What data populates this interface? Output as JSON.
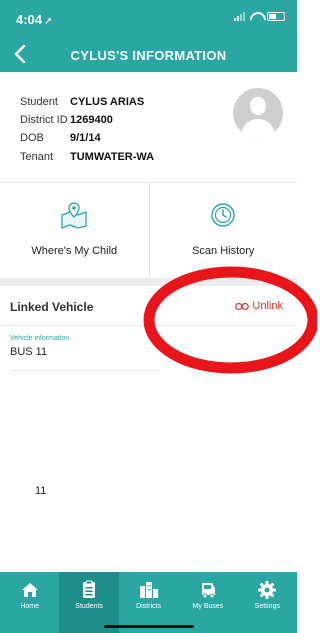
{
  "status_bar": {
    "time": "4:04"
  },
  "header": {
    "title": "CYLUS'S INFORMATION"
  },
  "student_info": {
    "rows": [
      {
        "label": "Student",
        "value": "CYLUS ARIAS"
      },
      {
        "label": "District ID",
        "value": "1269400"
      },
      {
        "label": "DOB",
        "value": "9/1/14"
      },
      {
        "label": "Tenant",
        "value": "TUMWATER-WA"
      }
    ]
  },
  "tiles": {
    "where": {
      "label": "Where's My Child",
      "icon": "map-location-icon"
    },
    "scan": {
      "label": "Scan History",
      "icon": "clock-history-icon"
    }
  },
  "linked_vehicle": {
    "title": "Linked Vehicle",
    "unlink_label": "Unlink",
    "vehicle_info_label": "Vehicle information",
    "vehicle_info_value": "BUS 11"
  },
  "stray_text": "11",
  "tabbar": {
    "tabs": [
      {
        "label": "Home",
        "icon": "home-icon"
      },
      {
        "label": "Students",
        "icon": "students-icon",
        "active": true
      },
      {
        "label": "Districts",
        "icon": "districts-icon"
      },
      {
        "label": "My Buses",
        "icon": "buses-icon"
      },
      {
        "label": "Settings",
        "icon": "gear-icon"
      }
    ]
  },
  "colors": {
    "primary": "#2aa6a3",
    "unlink": "#d9342b",
    "annotation": "#e8161b"
  }
}
